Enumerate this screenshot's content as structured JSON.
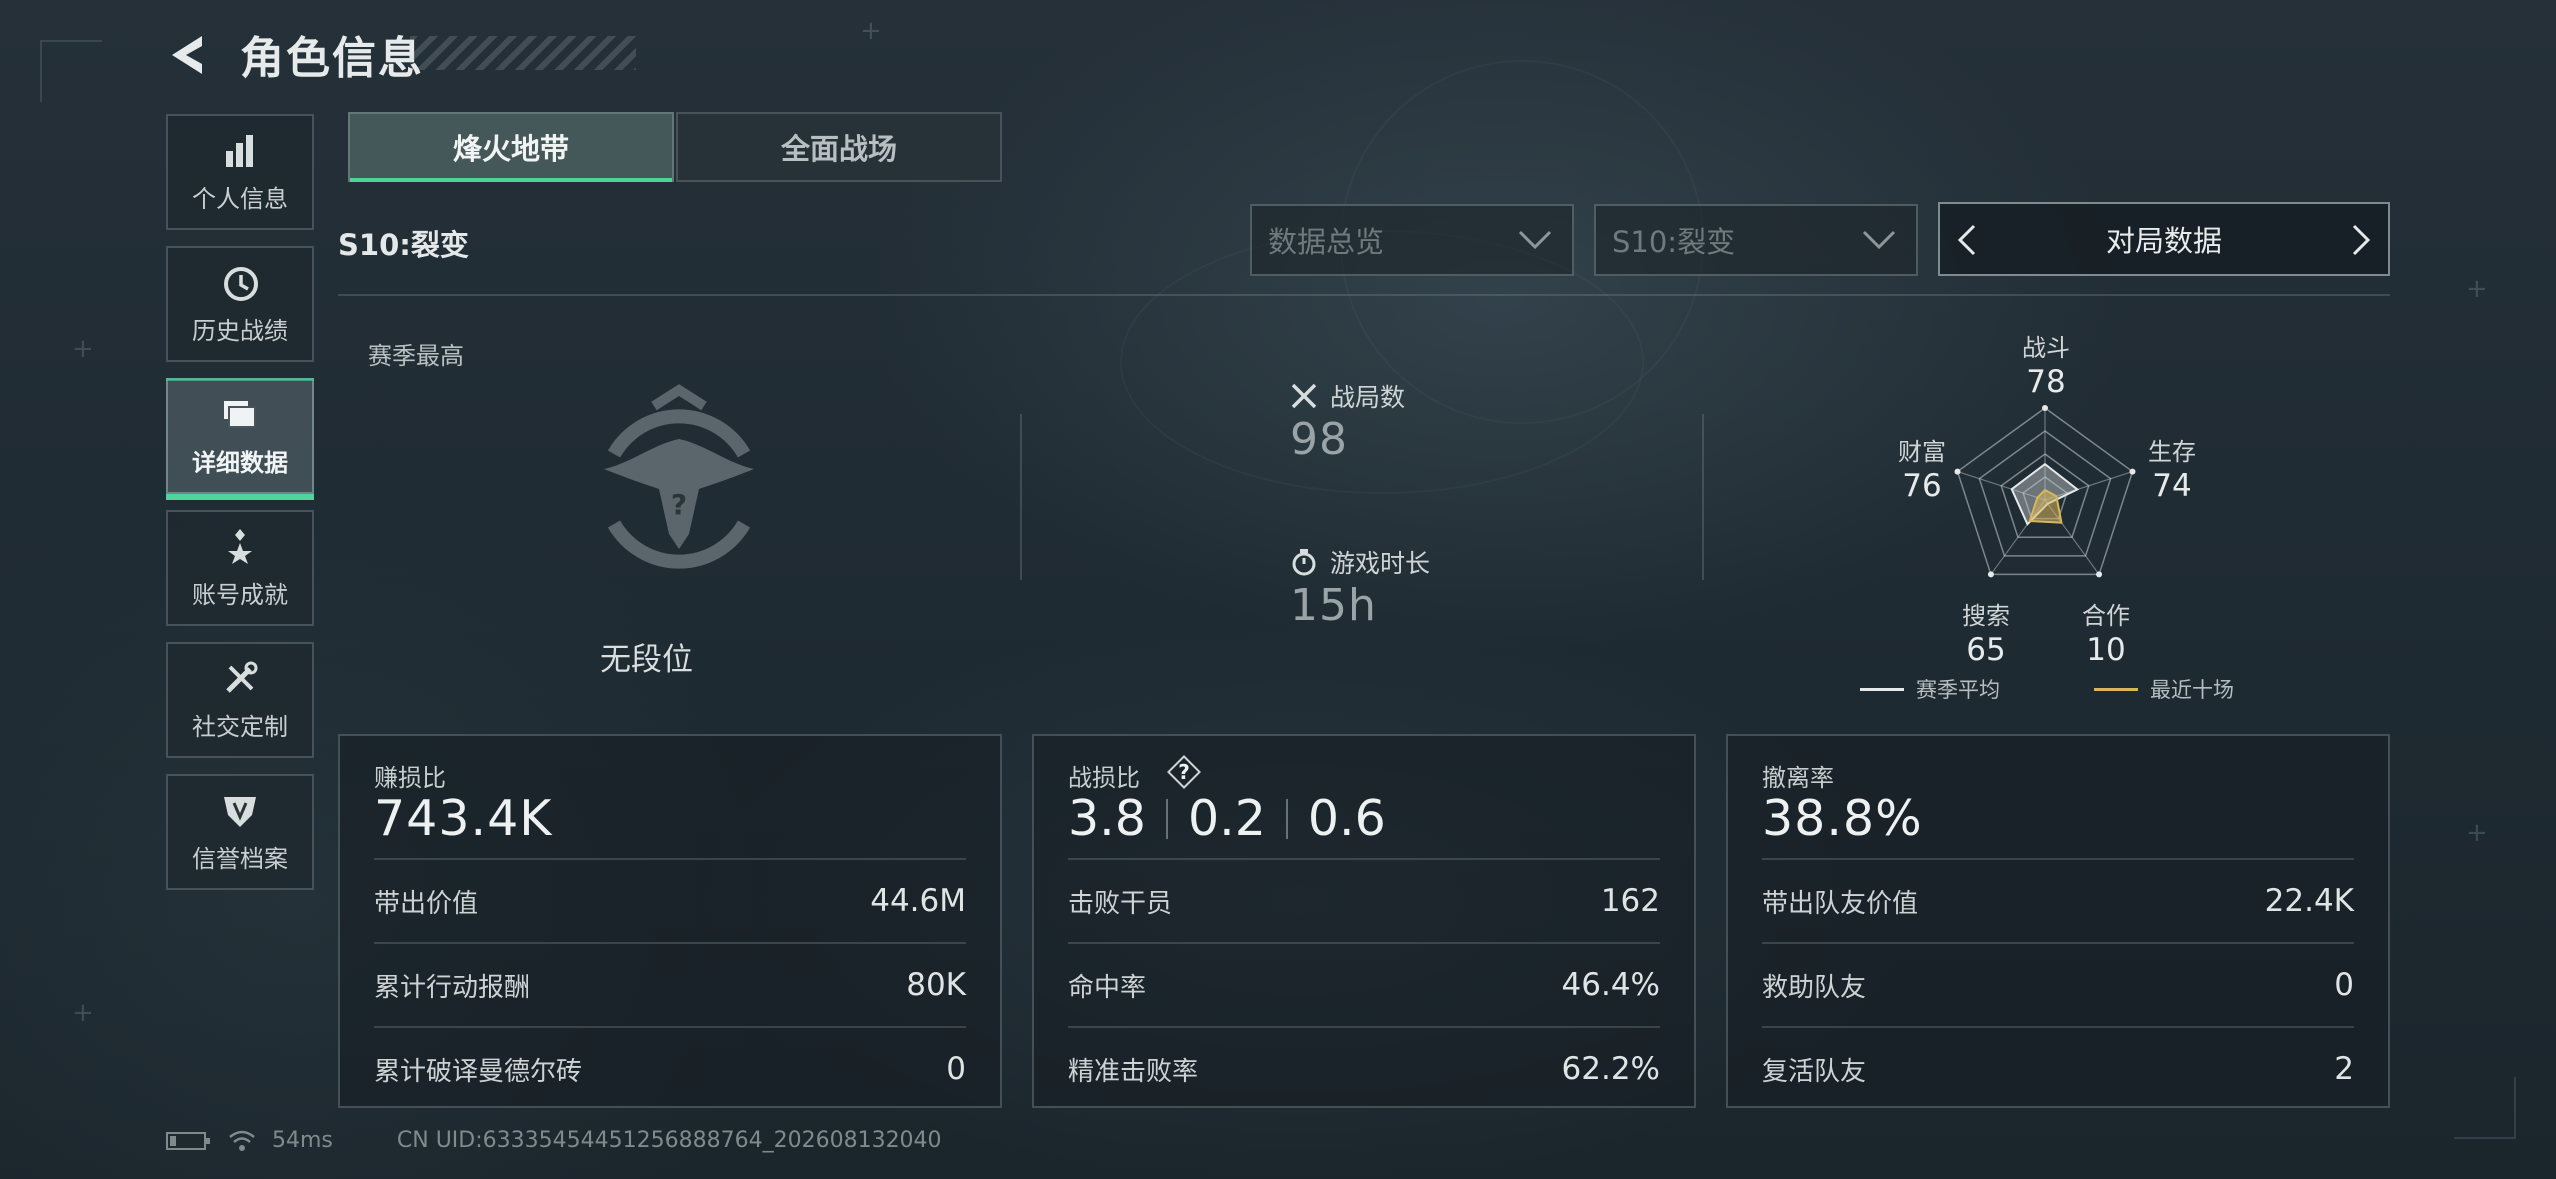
{
  "header": {
    "title": "角色信息"
  },
  "sidebar": {
    "items": [
      {
        "label": "个人信息",
        "icon": "bar-chart-icon"
      },
      {
        "label": "历史战绩",
        "icon": "clock-history-icon"
      },
      {
        "label": "详细数据",
        "icon": "folder-icon",
        "active": true
      },
      {
        "label": "账号成就",
        "icon": "medal-icon"
      },
      {
        "label": "社交定制",
        "icon": "tools-icon"
      },
      {
        "label": "信誉档案",
        "icon": "shield-icon"
      }
    ]
  },
  "tabs": [
    {
      "label": "烽火地带",
      "active": true
    },
    {
      "label": "全面战场",
      "active": false
    }
  ],
  "season_label": "S10:裂变",
  "filters": {
    "overview": "数据总览",
    "season": "S10:裂变",
    "pager_label": "对局数据"
  },
  "rank": {
    "section_label": "赛季最高",
    "rank_text": "无段位"
  },
  "stats": {
    "matches_label": "战局数",
    "matches_value": "98",
    "playtime_label": "游戏时长",
    "playtime_value": "15h"
  },
  "radar": {
    "axes": [
      {
        "label": "战斗",
        "value": "78"
      },
      {
        "label": "生存",
        "value": "74"
      },
      {
        "label": "合作",
        "value": "10"
      },
      {
        "label": "搜索",
        "value": "65"
      },
      {
        "label": "财富",
        "value": "76"
      }
    ],
    "series": [
      {
        "name": "赛季平均",
        "color": "#e6e9ea",
        "values": [
          78,
          74,
          10,
          65,
          76
        ]
      },
      {
        "name": "最近十场",
        "color": "#d9b65a"
      }
    ]
  },
  "cards": {
    "profit": {
      "title": "赚损比",
      "big": "743.4K",
      "rows": [
        {
          "k": "带出价值",
          "v": "44.6M"
        },
        {
          "k": "累计行动报酬",
          "v": "80K"
        },
        {
          "k": "累计破译曼德尔砖",
          "v": "0"
        }
      ]
    },
    "combat": {
      "title": "战损比",
      "kd": [
        "3.8",
        "0.2",
        "0.6"
      ],
      "rows": [
        {
          "k": "击败干员",
          "v": "162"
        },
        {
          "k": "命中率",
          "v": "46.4%"
        },
        {
          "k": "精准击败率",
          "v": "62.2%"
        }
      ]
    },
    "extract": {
      "title": "撤离率",
      "big": "38.8%",
      "rows": [
        {
          "k": "带出队友价值",
          "v": "22.4K"
        },
        {
          "k": "救助队友",
          "v": "0"
        },
        {
          "k": "复活队友",
          "v": "2"
        }
      ]
    }
  },
  "footer": {
    "ping": "54ms",
    "uid": "CN UID:63335454451256888764_202608132040"
  }
}
